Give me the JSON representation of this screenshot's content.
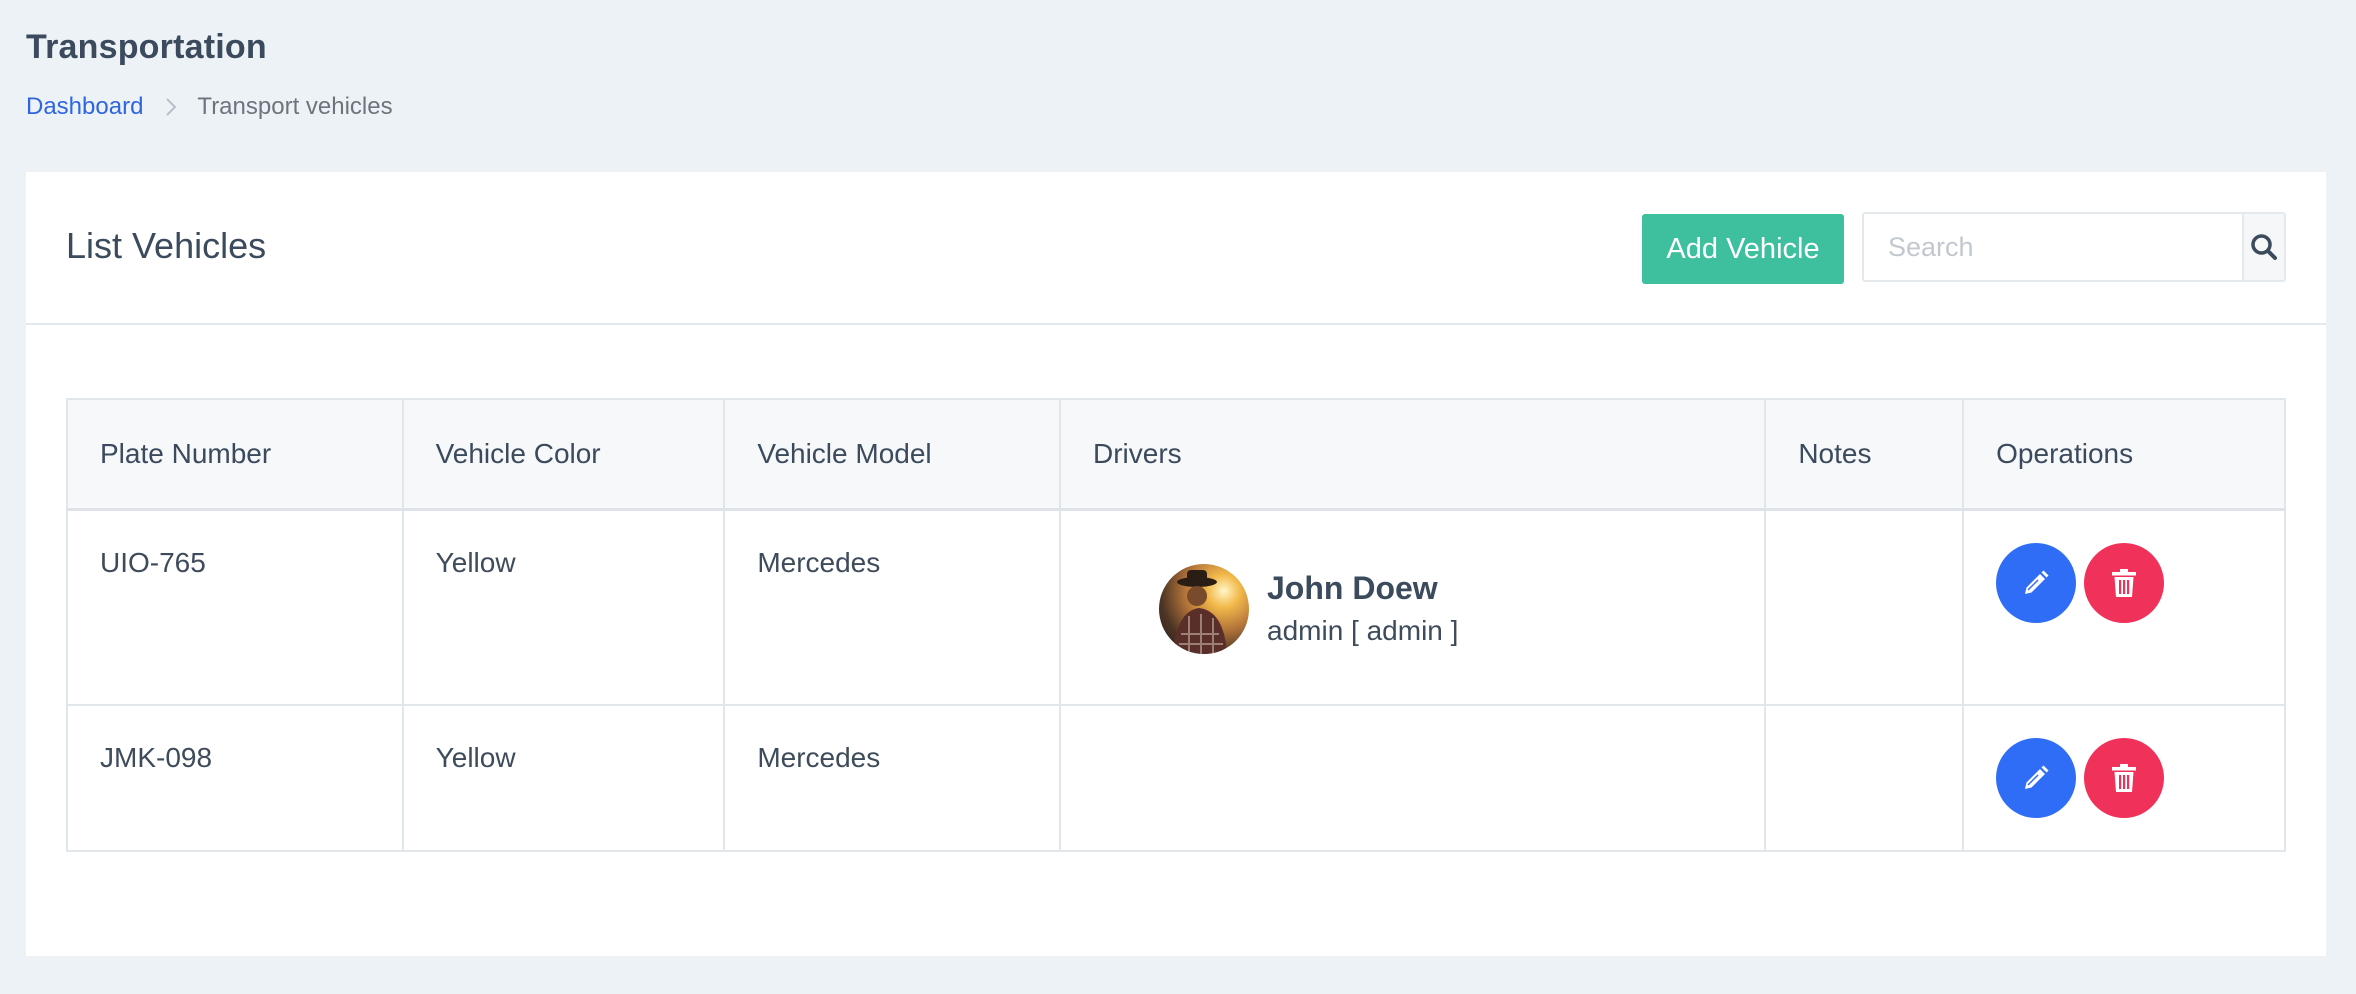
{
  "header": {
    "title": "Transportation",
    "breadcrumb": {
      "home": "Dashboard",
      "current": "Transport vehicles"
    }
  },
  "card": {
    "title": "List Vehicles",
    "add_button": "Add Vehicle",
    "search": {
      "placeholder": "Search",
      "value": ""
    }
  },
  "table": {
    "columns": [
      "Plate Number",
      "Vehicle Color",
      "Vehicle Model",
      "Drivers",
      "Notes",
      "Operations"
    ],
    "rows": [
      {
        "plate": "UIO-765",
        "color": "Yellow",
        "model": "Mercedes",
        "driver": {
          "name": "John Doew",
          "role": "admin [ admin ]"
        },
        "notes": ""
      },
      {
        "plate": "JMK-098",
        "color": "Yellow",
        "model": "Mercedes",
        "driver": null,
        "notes": ""
      }
    ]
  },
  "icons": {
    "breadcrumb_separator": "chevron-right-icon",
    "search": "search-icon",
    "edit": "pencil-icon",
    "delete": "trash-icon"
  },
  "colors": {
    "accent_green": "#3ebf9e",
    "link_blue": "#2f66e0",
    "edit_blue": "#2f6df6",
    "delete_red": "#f0315a",
    "background": "#edf2f6"
  }
}
